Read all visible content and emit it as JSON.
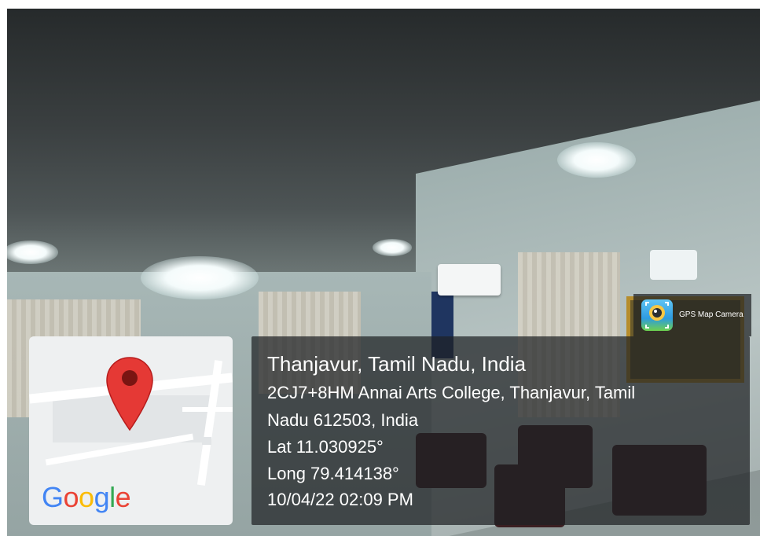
{
  "overlay": {
    "title": "Thanjavur, Tamil Nadu, India",
    "address_line_1": "2CJ7+8HM Annai Arts College, Thanjavur, Tamil",
    "address_line_2": "Nadu 612503, India",
    "latitude": "Lat 11.030925°",
    "longitude": "Long 79.414138°",
    "datetime": "10/04/22 02:09 PM"
  },
  "badge": {
    "app_name": "GPS Map Camera",
    "icon": "gps-map-camera-icon"
  },
  "map": {
    "logo_text": "Google",
    "pin_icon": "map-pin-icon",
    "logo_colors": [
      "#4285F4",
      "#EA4335",
      "#FBBC05",
      "#4285F4",
      "#34A853",
      "#EA4335"
    ],
    "pin_color": "#E53935"
  }
}
